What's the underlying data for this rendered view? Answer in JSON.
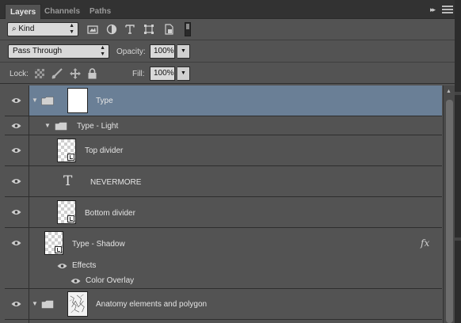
{
  "tabs": [
    {
      "label": "Layers",
      "active": true
    },
    {
      "label": "Channels",
      "active": false
    },
    {
      "label": "Paths",
      "active": false
    }
  ],
  "panel_controls": {
    "collapse_glyph": "▸▸",
    "menu_icon": "hamburger-icon"
  },
  "filter": {
    "kind_label": "Kind",
    "icons": [
      "pixel-filter-icon",
      "adjustment-filter-icon",
      "type-filter-icon",
      "shape-filter-icon",
      "smart-object-filter-icon",
      "filter-toggle-icon"
    ]
  },
  "blend": {
    "mode": "Pass Through",
    "opacity_label": "Opacity:",
    "opacity_value": "100%"
  },
  "lock": {
    "label": "Lock:",
    "icons": [
      "lock-transparent-icon",
      "lock-image-icon",
      "lock-position-icon",
      "lock-all-icon"
    ],
    "fill_label": "Fill:",
    "fill_value": "100%"
  },
  "layers": [
    {
      "name": "Type",
      "kind": "group",
      "expanded": true,
      "selected": true
    },
    {
      "name": "Type - Light",
      "kind": "group",
      "expanded": true
    },
    {
      "name": "Top divider",
      "kind": "smart-object"
    },
    {
      "name": "NEVERMORE",
      "kind": "text",
      "glyph": "T"
    },
    {
      "name": "Bottom divider",
      "kind": "smart-object"
    },
    {
      "name": "Type - Shadow",
      "kind": "smart-object",
      "fx": "fx",
      "effects_label": "Effects",
      "effects": [
        "Color Overlay"
      ]
    },
    {
      "name": "Anatomy elements and polygon",
      "kind": "group",
      "expanded": true
    }
  ],
  "colors": {
    "panel": "#535353",
    "selected_row": "#6a7f96",
    "tab_bar": "#323232"
  }
}
